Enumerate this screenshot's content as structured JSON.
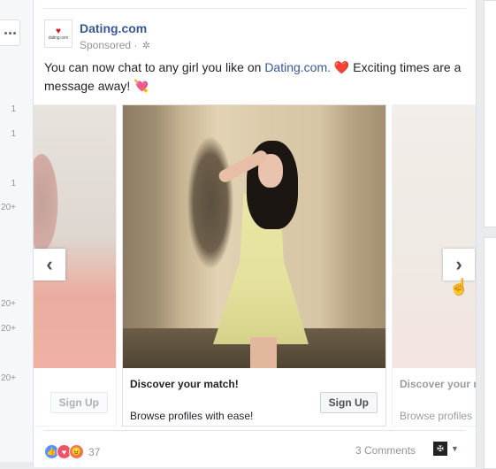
{
  "sidebar": {
    "counts": [
      "1",
      "1",
      "1",
      "20+",
      "20+",
      "20+",
      "20+"
    ]
  },
  "post": {
    "page_name": "Dating.com",
    "avatar_text": "dating.com",
    "sponsored": "Sponsored ·",
    "text_before": "You can now chat to any girl you like on ",
    "text_link": "Dating.com.",
    "text_after": " Exciting times are a message away!",
    "heart_emoji": "❤️",
    "arrow_heart_emoji": "💘"
  },
  "carousel": {
    "cards": [
      {
        "title": "",
        "description": "",
        "cta": "Sign Up"
      },
      {
        "title": "Discover your match!",
        "description": "Browse profiles with ease!",
        "cta": "Sign Up"
      },
      {
        "title": "Discover your m",
        "description": "Browse profiles",
        "cta": ""
      }
    ],
    "prev_glyph": "‹",
    "next_glyph": "›"
  },
  "footer": {
    "reaction_count": "37",
    "comments": "3 Comments"
  },
  "icons": {
    "like": "like-icon",
    "love": "love-icon",
    "angry": "angry-icon",
    "settings": "gear-icon"
  }
}
